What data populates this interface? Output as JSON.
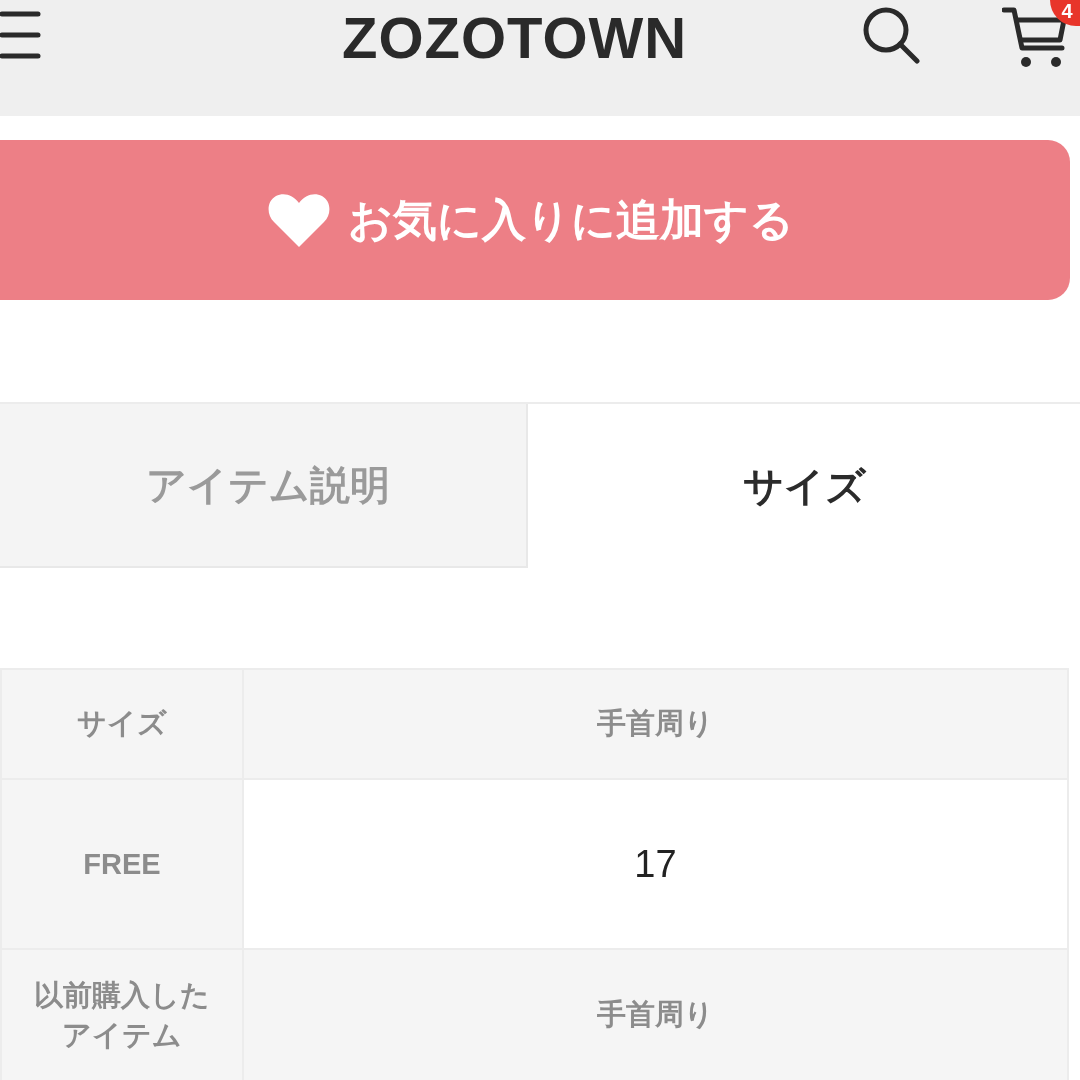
{
  "header": {
    "logo": "ZOZOTOWN",
    "cart_badge": "4"
  },
  "favorite_button": {
    "label": "お気に入りに追加する"
  },
  "tabs": [
    {
      "label": "アイテム説明",
      "selected": false
    },
    {
      "label": "サイズ",
      "selected": true
    }
  ],
  "size_table": {
    "columns": [
      "サイズ",
      "手首周り"
    ],
    "rows": [
      {
        "kind": "size",
        "cells": [
          "FREE",
          "17"
        ]
      },
      {
        "kind": "reference",
        "cells": [
          "以前購入したアイテム",
          "手首周り"
        ]
      }
    ]
  }
}
